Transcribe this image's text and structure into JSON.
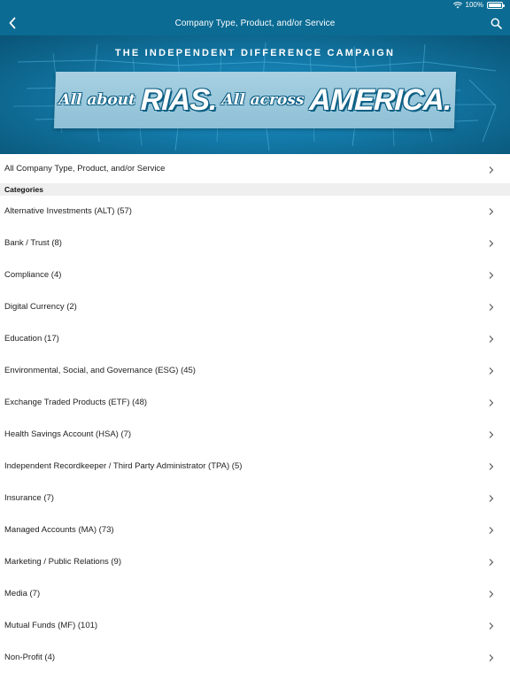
{
  "status": {
    "battery": "100%"
  },
  "nav": {
    "title": "Company Type, Product, and/or Service"
  },
  "banner": {
    "heading": "THE INDEPENDENT DIFFERENCE CAMPAIGN",
    "slogan_part1": "All about",
    "slogan_part2": "RIAS.",
    "slogan_part3": "All across",
    "slogan_part4": "AMERICA."
  },
  "list": {
    "all_label": "All Company Type, Product, and/or Service",
    "section_title": "Categories",
    "items": [
      {
        "label": "Alternative Investments (ALT) (57)"
      },
      {
        "label": "Bank / Trust (8)"
      },
      {
        "label": "Compliance (4)"
      },
      {
        "label": "Digital Currency (2)"
      },
      {
        "label": "Education (17)"
      },
      {
        "label": "Environmental, Social, and Governance (ESG) (45)"
      },
      {
        "label": "Exchange Traded Products (ETF) (48)"
      },
      {
        "label": "Health Savings Account (HSA) (7)"
      },
      {
        "label": "Independent Recordkeeper / Third Party Administrator (TPA) (5)"
      },
      {
        "label": "Insurance (7)"
      },
      {
        "label": "Managed Accounts (MA) (73)"
      },
      {
        "label": "Marketing / Public Relations (9)"
      },
      {
        "label": "Media (7)"
      },
      {
        "label": "Mutual Funds (MF) (101)"
      },
      {
        "label": "Non-Profit (4)"
      }
    ]
  },
  "colors": {
    "header_bg": "#0b6b93",
    "section_bg": "#efefef",
    "banner_plate": "#a7d0e2"
  },
  "icons": {
    "back": "chevron-left-icon",
    "search": "search-icon",
    "row": "chevron-right-icon",
    "wifi": "wifi-icon",
    "battery": "battery-icon"
  }
}
